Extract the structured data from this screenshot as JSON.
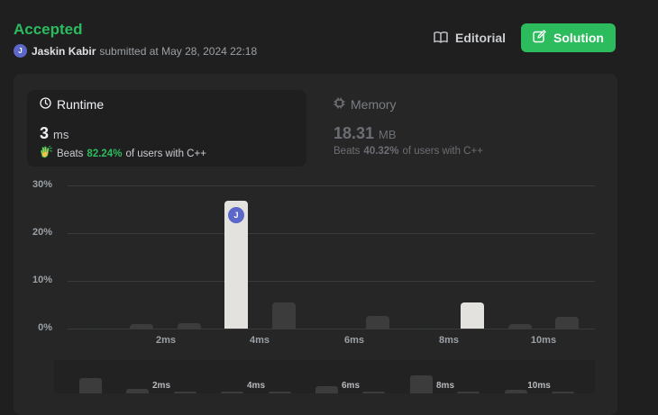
{
  "submission": {
    "status": "Accepted",
    "avatar_letter": "J",
    "username": "Jaskin Kabir",
    "submitted_text": "submitted at May 28, 2024 22:18"
  },
  "actions": {
    "editorial_label": "Editorial",
    "solution_label": "Solution"
  },
  "runtime": {
    "title": "Runtime",
    "value": "3",
    "unit": "ms",
    "beats_label": "Beats",
    "beats_pct": "82.24%",
    "beats_suffix": "of users with C++"
  },
  "memory": {
    "title": "Memory",
    "value": "18.31",
    "unit": "MB",
    "beats_label": "Beats",
    "beats_pct": "40.32%",
    "beats_suffix": "of users with C++"
  },
  "colors": {
    "accepted": "#2cbb5d",
    "solution_button": "#2cbb5d",
    "highlight_bar": "#e3e2de",
    "bar": "#3c3c3c"
  },
  "chart_data": {
    "type": "bar",
    "ylabel": "",
    "xlabel": "",
    "y_ticks": [
      "0%",
      "10%",
      "20%",
      "30%"
    ],
    "ylim": [
      0,
      30
    ],
    "x_ticks": [
      "2ms",
      "4ms",
      "6ms",
      "8ms",
      "10ms"
    ],
    "x_tick_values": [
      2,
      4,
      6,
      8,
      10
    ],
    "bars": [
      {
        "x": 0,
        "value": 0.2,
        "faint": true
      },
      {
        "x": 1,
        "value": 1.0
      },
      {
        "x": 2,
        "value": 1.2
      },
      {
        "x": 3,
        "value": 26.8,
        "selected": true
      },
      {
        "x": 4,
        "value": 5.4
      },
      {
        "x": 5,
        "value": 0.2,
        "faint": true
      },
      {
        "x": 6,
        "value": 2.6
      },
      {
        "x": 7,
        "value": 0.2,
        "faint": true
      },
      {
        "x": 8,
        "value": 5.4,
        "highlight": true
      },
      {
        "x": 9,
        "value": 1.0
      },
      {
        "x": 10,
        "value": 2.4
      }
    ],
    "selected_marker": "J",
    "overview": {
      "x_ticks": [
        "2ms",
        "4ms",
        "6ms",
        "8ms",
        "10ms"
      ],
      "values": [
        3.6,
        1.0,
        0.2,
        0.4,
        0.2,
        1.8,
        0.2,
        4.4,
        0.2,
        0.8,
        0.2
      ]
    }
  }
}
